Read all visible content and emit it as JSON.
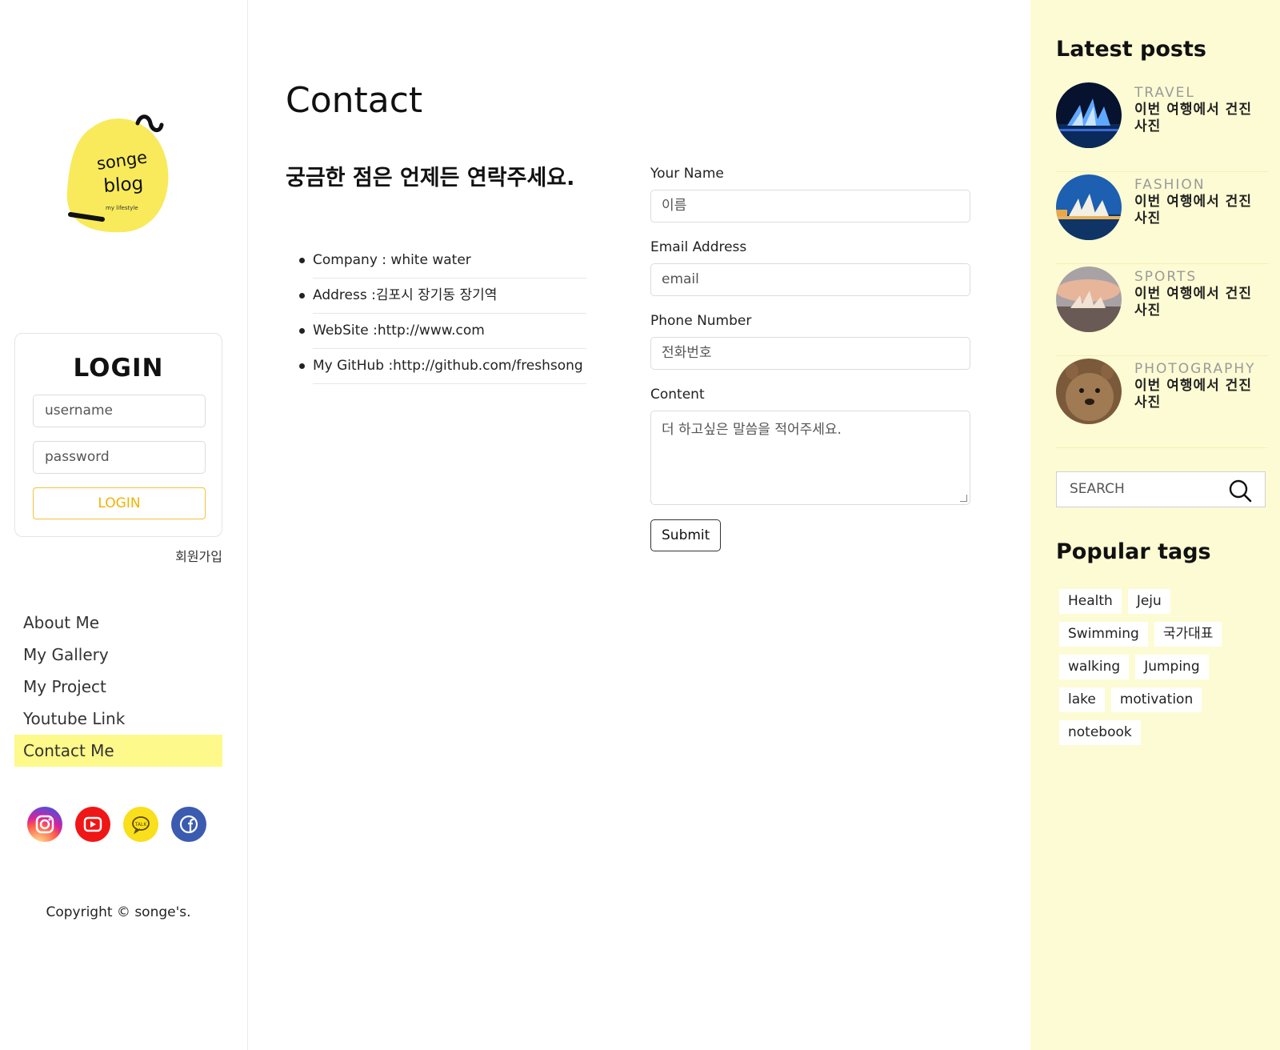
{
  "logo": {
    "line1": "songe",
    "line2": "blog",
    "tagline": "my lifestyle"
  },
  "login": {
    "title": "LOGIN",
    "username_placeholder": "username",
    "password_placeholder": "password",
    "button": "LOGIN",
    "signup": "회원가입"
  },
  "nav": {
    "items": [
      {
        "label": "About Me"
      },
      {
        "label": "My Gallery"
      },
      {
        "label": "My Project"
      },
      {
        "label": "Youtube Link"
      },
      {
        "label": "Contact Me"
      }
    ],
    "active": "Contact Me"
  },
  "social": [
    {
      "icon": "instagram-icon",
      "color": "#d62976"
    },
    {
      "icon": "youtube-icon",
      "color": "#ff0000"
    },
    {
      "icon": "kakaotalk-icon",
      "color": "#fae100"
    },
    {
      "icon": "facebook-icon",
      "color": "#3b5998"
    }
  ],
  "copyright": "Copyright © songe's.",
  "main": {
    "title": "Contact",
    "intro": "궁금한 점은 언제든 연락주세요.",
    "info": [
      "Company : white water",
      "Address :김포시 장기동 장기역",
      "WebSite :http://www.com",
      "My GitHub :http://github.com/freshsong"
    ],
    "form": {
      "name_label": "Your Name",
      "name_placeholder": "이름",
      "email_label": "Email Address",
      "email_placeholder": "email",
      "phone_label": "Phone Number",
      "phone_placeholder": "전화번호",
      "content_label": "Content",
      "content_placeholder": "더 하고싶은 말씀을 적어주세요.",
      "submit": "Submit"
    }
  },
  "right": {
    "latest_title": "Latest posts",
    "posts": [
      {
        "category": "TRAVEL",
        "title": "이번 여행에서 건진 사진"
      },
      {
        "category": "FASHION",
        "title": "이번 여행에서 건진 사진"
      },
      {
        "category": "SPORTS",
        "title": "이번 여행에서 건진 사진"
      },
      {
        "category": "PHOTOGRAPHY",
        "title": "이번 여행에서 건진 사진"
      }
    ],
    "search_placeholder": "SEARCH",
    "tags_title": "Popular tags",
    "tags": [
      "Health",
      "Jeju",
      "Swimming",
      "국가대표",
      "walking",
      "Jumping",
      "lake",
      "motivation",
      "notebook"
    ]
  },
  "colors": {
    "accent_yellow": "#fdf98a",
    "right_bg": "#fdfbd3",
    "login_btn": "#f0b400"
  }
}
